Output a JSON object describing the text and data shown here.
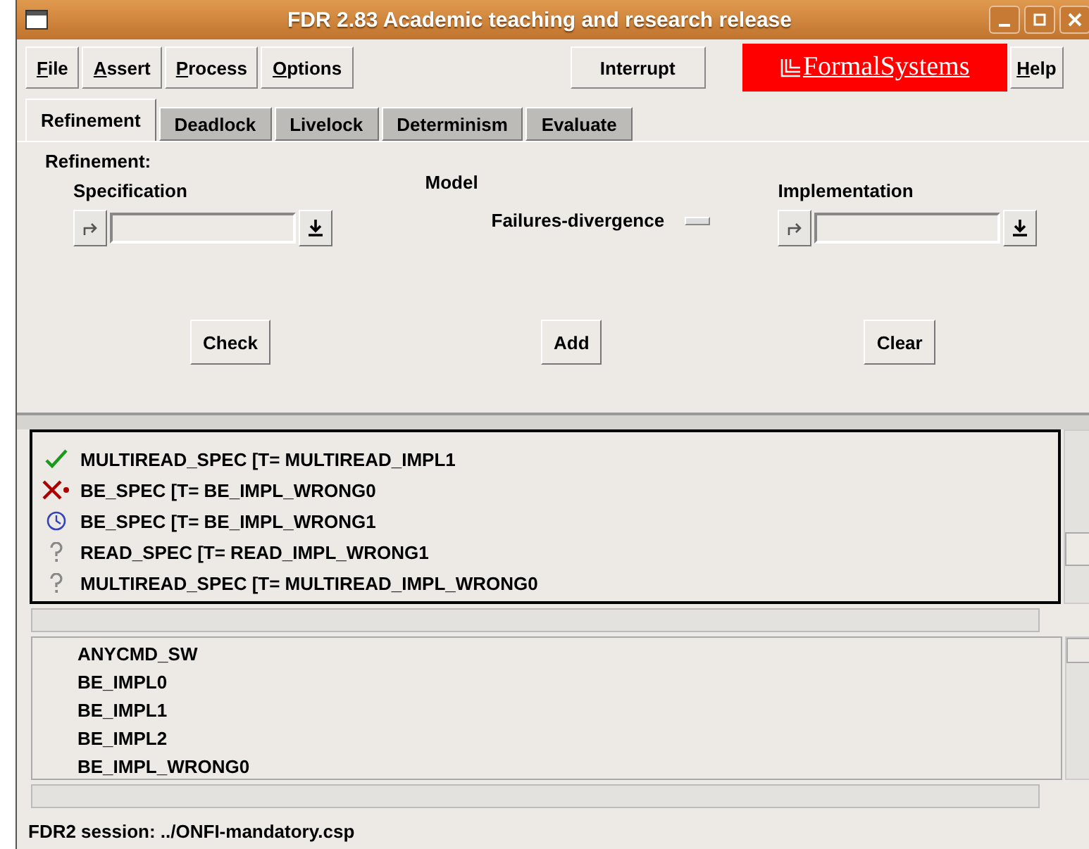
{
  "window": {
    "title": "FDR 2.83 Academic teaching and research release"
  },
  "menu": [
    {
      "label": "File"
    },
    {
      "label": "Assert"
    },
    {
      "label": "Process"
    },
    {
      "label": "Options"
    }
  ],
  "interrupt_button": "Interrupt",
  "logo": "FormalSystems",
  "help_menu": "Help",
  "tabs": [
    {
      "label": "Refinement",
      "selected": true
    },
    {
      "label": "Deadlock",
      "selected": false
    },
    {
      "label": "Livelock",
      "selected": false
    },
    {
      "label": "Determinism",
      "selected": false
    },
    {
      "label": "Evaluate",
      "selected": false
    }
  ],
  "panel": {
    "heading": "Refinement:",
    "specification_label": "Specification",
    "model_label": "Model",
    "model_value": "Failures-divergence",
    "implementation_label": "Implementation",
    "buttons": [
      "Check",
      "Add",
      "Clear"
    ]
  },
  "assertions": [
    {
      "kind": "passed",
      "text": "MULTIREAD_SPEC [T= MULTIREAD_IMPL1"
    },
    {
      "kind": "failed",
      "text": "BE_SPEC [T= BE_IMPL_WRONG0"
    },
    {
      "kind": "running",
      "text": "BE_SPEC [T= BE_IMPL_WRONG1"
    },
    {
      "kind": "unknown",
      "text": "READ_SPEC [T= READ_IMPL_WRONG1"
    },
    {
      "kind": "unknown",
      "text": "MULTIREAD_SPEC [T= MULTIREAD_IMPL_WRONG0"
    }
  ],
  "processes": [
    "ANYCMD_SW",
    "BE_IMPL0",
    "BE_IMPL1",
    "BE_IMPL2",
    "BE_IMPL_WRONG0"
  ],
  "status_bar": "FDR2 session: ../ONFI-mandatory.csp"
}
